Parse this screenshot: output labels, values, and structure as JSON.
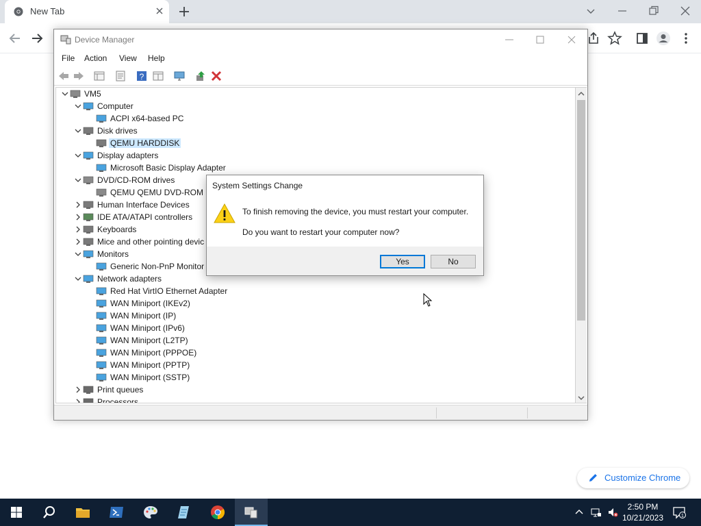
{
  "chrome": {
    "tab_title": "New Tab",
    "customize_label": "Customize Chrome"
  },
  "device_manager": {
    "title": "Device Manager",
    "menu": [
      "File",
      "Action",
      "View",
      "Help"
    ],
    "tree": [
      {
        "label": "VM5",
        "level": 0,
        "expanded": true,
        "icon": "computer-root-icon"
      },
      {
        "label": "Computer",
        "level": 1,
        "expanded": true,
        "icon": "monitor-icon"
      },
      {
        "label": "ACPI x64-based PC",
        "level": 2,
        "icon": "monitor-icon"
      },
      {
        "label": "Disk drives",
        "level": 1,
        "expanded": true,
        "icon": "disk-icon"
      },
      {
        "label": "QEMU HARDDISK",
        "level": 2,
        "icon": "disk-icon",
        "selected": true
      },
      {
        "label": "Display adapters",
        "level": 1,
        "expanded": true,
        "icon": "display-adapter-icon"
      },
      {
        "label": "Microsoft Basic Display Adapter",
        "level": 2,
        "icon": "display-adapter-icon"
      },
      {
        "label": "DVD/CD-ROM drives",
        "level": 1,
        "expanded": true,
        "icon": "dvd-icon"
      },
      {
        "label": "QEMU QEMU DVD-ROM",
        "level": 2,
        "icon": "dvd-icon"
      },
      {
        "label": "Human Interface Devices",
        "level": 1,
        "expanded": false,
        "icon": "hid-icon"
      },
      {
        "label": "IDE ATA/ATAPI controllers",
        "level": 1,
        "expanded": false,
        "icon": "ide-icon"
      },
      {
        "label": "Keyboards",
        "level": 1,
        "expanded": false,
        "icon": "keyboard-icon"
      },
      {
        "label": "Mice and other pointing devic",
        "level": 1,
        "expanded": false,
        "icon": "mouse-icon"
      },
      {
        "label": "Monitors",
        "level": 1,
        "expanded": true,
        "icon": "monitor-icon"
      },
      {
        "label": "Generic Non-PnP Monitor",
        "level": 2,
        "icon": "monitor-icon"
      },
      {
        "label": "Network adapters",
        "level": 1,
        "expanded": true,
        "icon": "network-icon"
      },
      {
        "label": "Red Hat VirtIO Ethernet Adapter",
        "level": 2,
        "icon": "network-icon"
      },
      {
        "label": "WAN Miniport (IKEv2)",
        "level": 2,
        "icon": "network-icon"
      },
      {
        "label": "WAN Miniport (IP)",
        "level": 2,
        "icon": "network-icon"
      },
      {
        "label": "WAN Miniport (IPv6)",
        "level": 2,
        "icon": "network-icon"
      },
      {
        "label": "WAN Miniport (L2TP)",
        "level": 2,
        "icon": "network-icon"
      },
      {
        "label": "WAN Miniport (PPPOE)",
        "level": 2,
        "icon": "network-icon"
      },
      {
        "label": "WAN Miniport (PPTP)",
        "level": 2,
        "icon": "network-icon"
      },
      {
        "label": "WAN Miniport (SSTP)",
        "level": 2,
        "icon": "network-icon"
      },
      {
        "label": "Print queues",
        "level": 1,
        "expanded": false,
        "icon": "printer-icon"
      },
      {
        "label": "Processors",
        "level": 1,
        "expanded": false,
        "icon": "processor-icon"
      }
    ]
  },
  "dialog": {
    "title": "System Settings Change",
    "message": "To finish removing the device, you must restart your computer.",
    "question": "Do you want to restart your computer now?",
    "yes_label": "Yes",
    "no_label": "No"
  },
  "taskbar": {
    "time": "2:50 PM",
    "date": "10/21/2023",
    "notification_count": "1"
  }
}
